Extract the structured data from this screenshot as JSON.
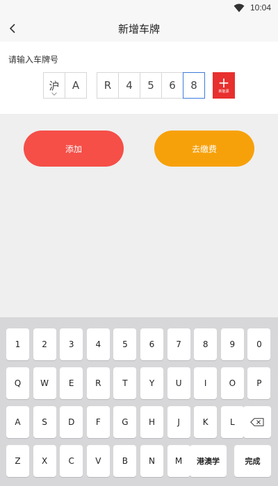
{
  "status": {
    "time": "10:04"
  },
  "header": {
    "title": "新增车牌"
  },
  "plate": {
    "label": "请输入车牌号",
    "cells": [
      "沪",
      "A",
      "R",
      "4",
      "5",
      "6",
      "8"
    ],
    "new_energy_label": "新能源"
  },
  "actions": {
    "add_label": "添加",
    "pay_label": "去缴费"
  },
  "keyboard": {
    "rows": [
      [
        "1",
        "2",
        "3",
        "4",
        "5",
        "6",
        "7",
        "8",
        "9",
        "0"
      ],
      [
        "Q",
        "W",
        "E",
        "R",
        "T",
        "Y",
        "U",
        "I",
        "O",
        "P"
      ],
      [
        "A",
        "S",
        "D",
        "F",
        "G",
        "H",
        "J",
        "K",
        "L"
      ],
      [
        "Z",
        "X",
        "C",
        "V",
        "B",
        "N",
        "M"
      ]
    ],
    "region_label": "港澳学",
    "done_label": "完成"
  },
  "colors": {
    "add": "#f54f48",
    "pay": "#f7a10a",
    "new_energy": "#e8302e",
    "active_border": "#3b7bd9"
  }
}
